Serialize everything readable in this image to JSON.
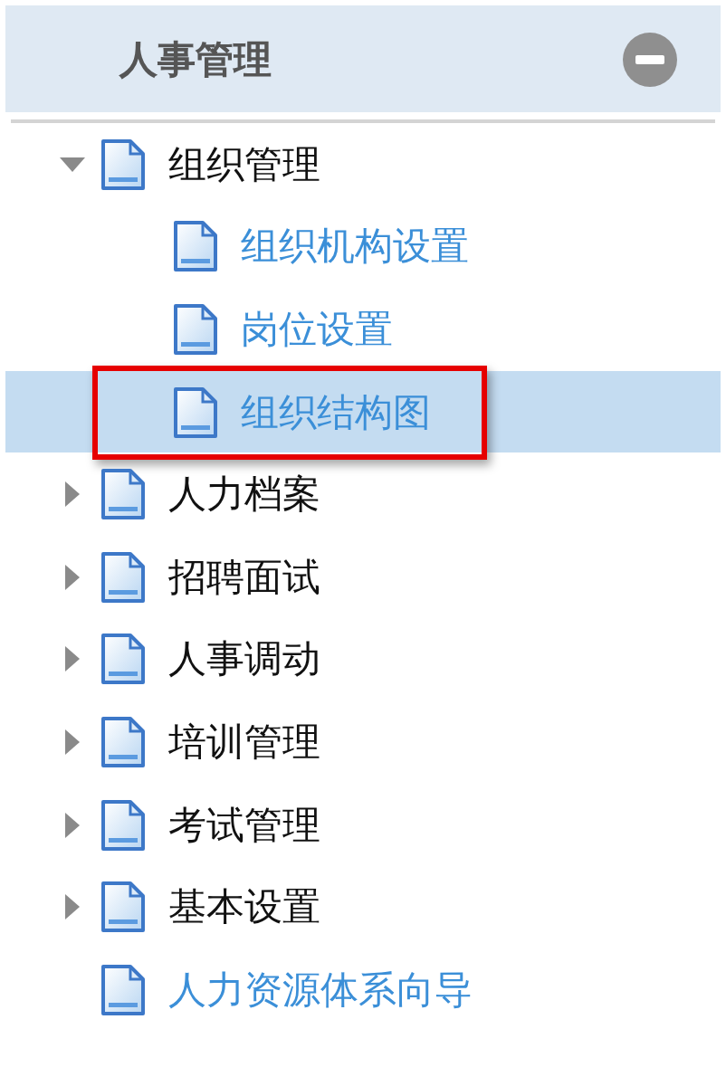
{
  "panel": {
    "title": "人事管理",
    "collapsed": false
  },
  "tree": [
    {
      "label": "组织管理",
      "kind": "folder",
      "expanded": true,
      "selected": false,
      "children": [
        {
          "label": "组织机构设置",
          "kind": "link",
          "selected": false
        },
        {
          "label": "岗位设置",
          "kind": "link",
          "selected": false
        },
        {
          "label": "组织结构图",
          "kind": "link",
          "selected": true
        }
      ]
    },
    {
      "label": "人力档案",
      "kind": "folder",
      "expanded": false,
      "selected": false
    },
    {
      "label": "招聘面试",
      "kind": "folder",
      "expanded": false,
      "selected": false
    },
    {
      "label": "人事调动",
      "kind": "folder",
      "expanded": false,
      "selected": false
    },
    {
      "label": "培训管理",
      "kind": "folder",
      "expanded": false,
      "selected": false
    },
    {
      "label": "考试管理",
      "kind": "folder",
      "expanded": false,
      "selected": false
    },
    {
      "label": "基本设置",
      "kind": "folder",
      "expanded": false,
      "selected": false
    },
    {
      "label": "人力资源体系向导",
      "kind": "link",
      "selected": false
    }
  ]
}
